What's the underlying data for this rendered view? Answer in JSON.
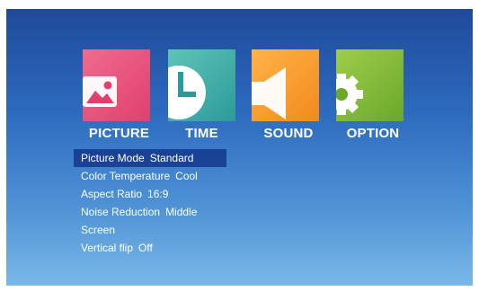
{
  "tabs": [
    {
      "label": "PICTURE"
    },
    {
      "label": "TIME"
    },
    {
      "label": "SOUND"
    },
    {
      "label": "OPTION"
    }
  ],
  "selected_tab": "PICTURE",
  "picture_menu": [
    {
      "label": "Picture Mode",
      "value": "Standard",
      "selected": true
    },
    {
      "label": "Color Temperature",
      "value": "Cool"
    },
    {
      "label": "Aspect Ratio",
      "value": "16:9"
    },
    {
      "label": "Noise Reduction",
      "value": "Middle"
    },
    {
      "label": "Screen",
      "value": ""
    },
    {
      "label": "Vertical flip",
      "value": "Off"
    }
  ],
  "colors": {
    "picture_tile": "#e0406e",
    "time_tile": "#2d9a9a",
    "sound_tile": "#f28a1e",
    "option_tile": "#6aa82a",
    "highlight": "#14378c"
  },
  "icons": [
    "picture-icon",
    "clock-icon",
    "speaker-icon",
    "gear-icon"
  ]
}
